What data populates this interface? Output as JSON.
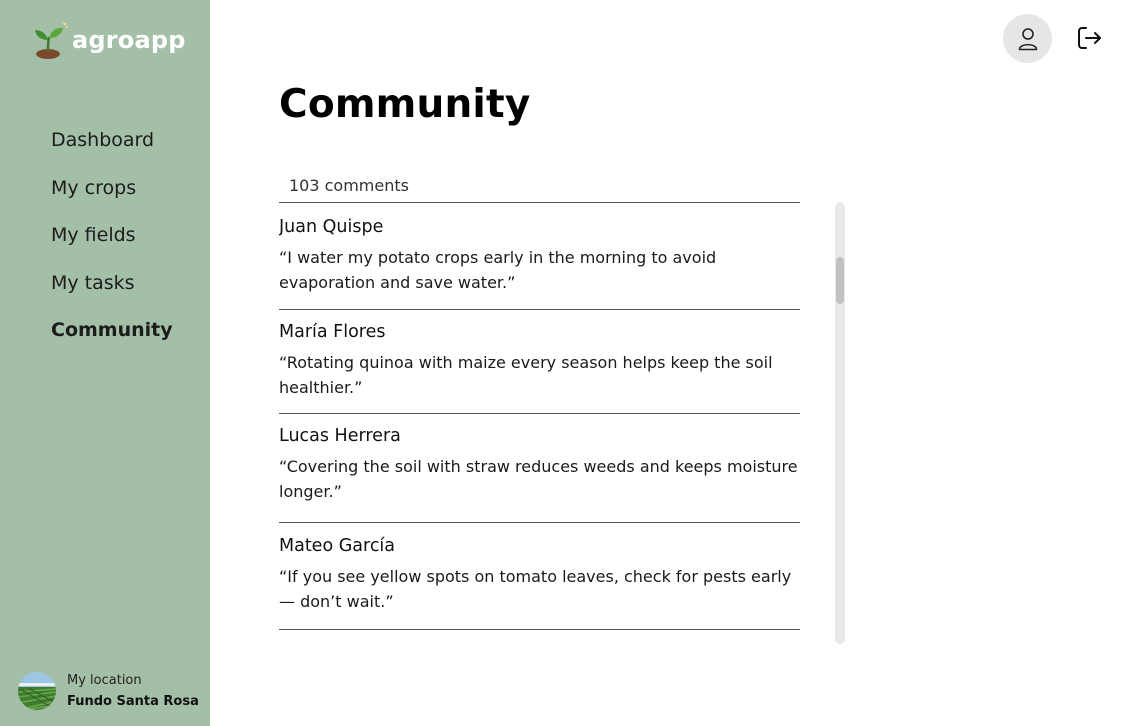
{
  "app": {
    "name": "agroapp"
  },
  "sidebar": {
    "items": [
      {
        "label": "Dashboard",
        "active": false
      },
      {
        "label": "My crops",
        "active": false
      },
      {
        "label": "My fields",
        "active": false
      },
      {
        "label": "My tasks",
        "active": false
      },
      {
        "label": "Community",
        "active": true
      }
    ],
    "location": {
      "label": "My location",
      "name": "Fundo Santa Rosa"
    }
  },
  "header": {
    "user_icon": "user-icon",
    "logout_icon": "logout-icon"
  },
  "main": {
    "title": "Community",
    "comments_count": "103 comments",
    "comments": [
      {
        "author": "Juan Quispe",
        "text": "“I water my potato crops early in the morning to avoid evaporation and save water.”"
      },
      {
        "author": "María Flores",
        "text": "“Rotating quinoa with maize every season helps keep the soil healthier.”"
      },
      {
        "author": "Lucas Herrera",
        "text": "“Covering the soil with straw reduces weeds and keeps moisture longer.”"
      },
      {
        "author": "Mateo García",
        "text": "“If you see yellow spots on tomato leaves, check for pests early — don’t wait.”"
      }
    ]
  },
  "colors": {
    "sidebar": "#a4bfa7",
    "text": "#111111",
    "divider": "#555555",
    "avatar_button": "#e6e6e6"
  }
}
